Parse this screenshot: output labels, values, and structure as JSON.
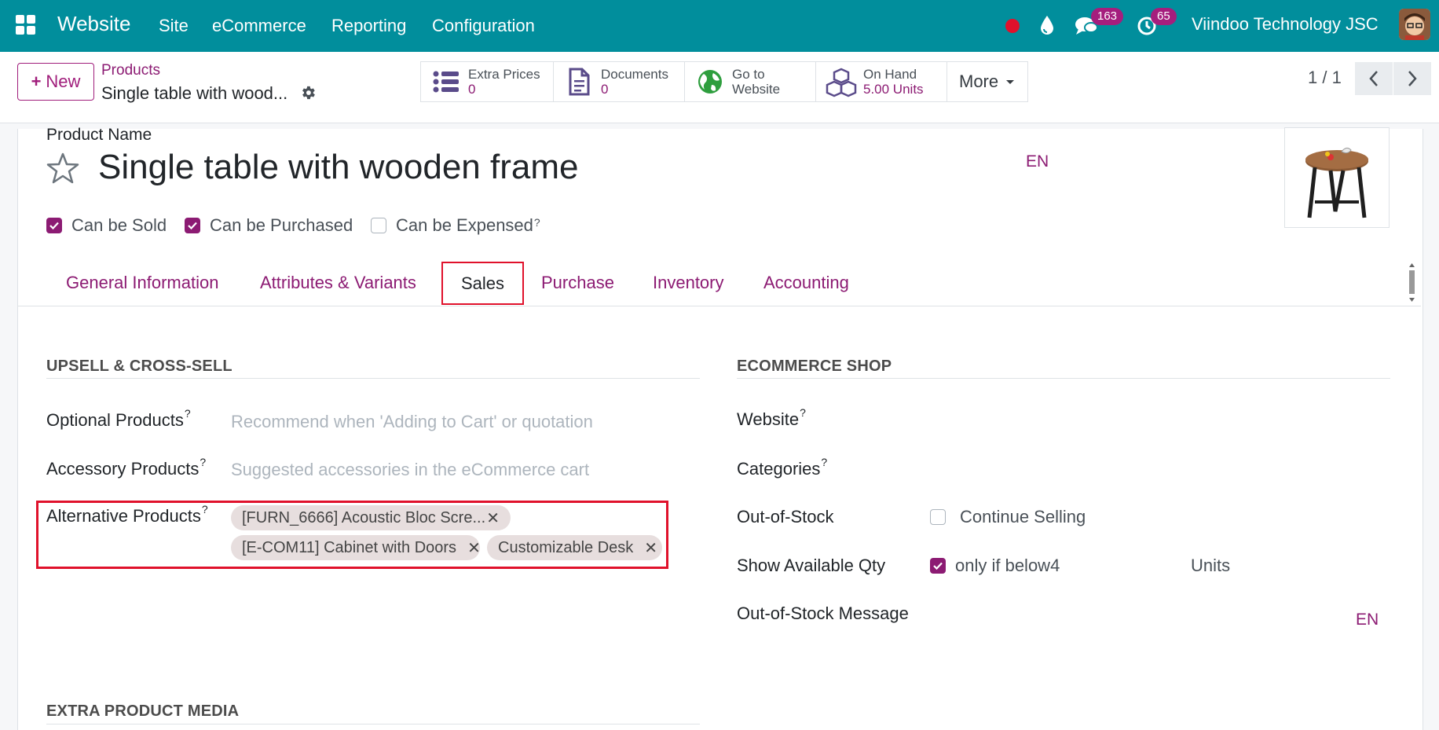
{
  "navbar": {
    "brand": "Website",
    "menu": [
      "Site",
      "eCommerce",
      "Reporting",
      "Configuration"
    ],
    "messages_count": "163",
    "activities_count": "65",
    "company": "Viindoo Technology JSC"
  },
  "control_panel": {
    "new_label": "New",
    "breadcrumb_parent": "Products",
    "breadcrumb_current": "Single table with wood...",
    "smart_buttons": {
      "extra_prices": {
        "label": "Extra Prices",
        "value": "0"
      },
      "documents": {
        "label": "Documents",
        "value": "0"
      },
      "go_to_website": {
        "line1": "Go to",
        "line2": "Website"
      },
      "on_hand": {
        "label": "On Hand",
        "value": "5.00 Units"
      }
    },
    "more_label": "More",
    "pager": "1 / 1"
  },
  "form": {
    "product_name_label": "Product Name",
    "product_name": "Single table with wooden frame",
    "lang_code": "EN",
    "checkboxes": {
      "can_be_sold": {
        "label": "Can be Sold",
        "checked": true
      },
      "can_be_purchased": {
        "label": "Can be Purchased",
        "checked": true
      },
      "can_be_expensed": {
        "label": "Can be Expensed",
        "checked": false
      }
    },
    "help_mark": "?",
    "tabs": [
      "General Information",
      "Attributes & Variants",
      "Sales",
      "Purchase",
      "Inventory",
      "Accounting"
    ],
    "active_tab": "Sales",
    "upsell": {
      "title": "UPSELL & CROSS-SELL",
      "optional_products": {
        "label": "Optional Products",
        "placeholder": "Recommend when 'Adding to Cart' or quotation"
      },
      "accessory_products": {
        "label": "Accessory Products",
        "placeholder": "Suggested accessories in the eCommerce cart"
      },
      "alternative_products": {
        "label": "Alternative Products",
        "tags": [
          "[FURN_6666] Acoustic Bloc Scre...",
          "[E-COM11] Cabinet with Doors",
          "Customizable Desk"
        ]
      }
    },
    "ecommerce": {
      "title": "ECOMMERCE SHOP",
      "website_label": "Website",
      "categories_label": "Categories",
      "out_of_stock_label": "Out-of-Stock",
      "continue_selling": {
        "label": "Continue Selling",
        "checked": false
      },
      "show_qty_label": "Show Available Qty",
      "only_if_below": {
        "label": "only if below",
        "value": "4",
        "checked": true
      },
      "units_label": "Units",
      "oos_message_label": "Out-of-Stock Message",
      "lang_code": "EN"
    },
    "extra_media_title": "EXTRA PRODUCT MEDIA"
  },
  "colors": {
    "navbar": "#018e9c",
    "accent": "#8c1b73",
    "highlight": "#e0112b"
  }
}
